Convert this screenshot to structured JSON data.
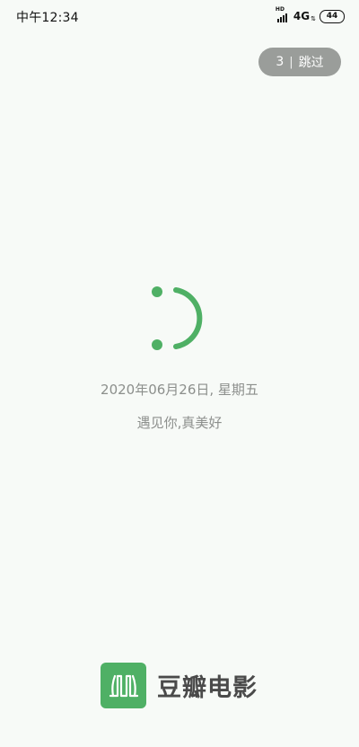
{
  "status_bar": {
    "time": "中午12:34",
    "signal_badge": "HD",
    "network": "4G",
    "battery": "44"
  },
  "skip": {
    "countdown": "3",
    "separator": "|",
    "label": "跳过"
  },
  "splash": {
    "date": "2020年06月26日, 星期五",
    "slogan": "遇见你,真美好"
  },
  "brand": {
    "name": "豆瓣电影"
  },
  "colors": {
    "accent": "#4fb065",
    "background": "#f7faf7",
    "skip_button": "#9a9d9a",
    "muted_text": "#8c8f8c"
  },
  "icons": {
    "logo_icon": "douban-movie-logo-icon",
    "smiley": "smiley-icon"
  }
}
